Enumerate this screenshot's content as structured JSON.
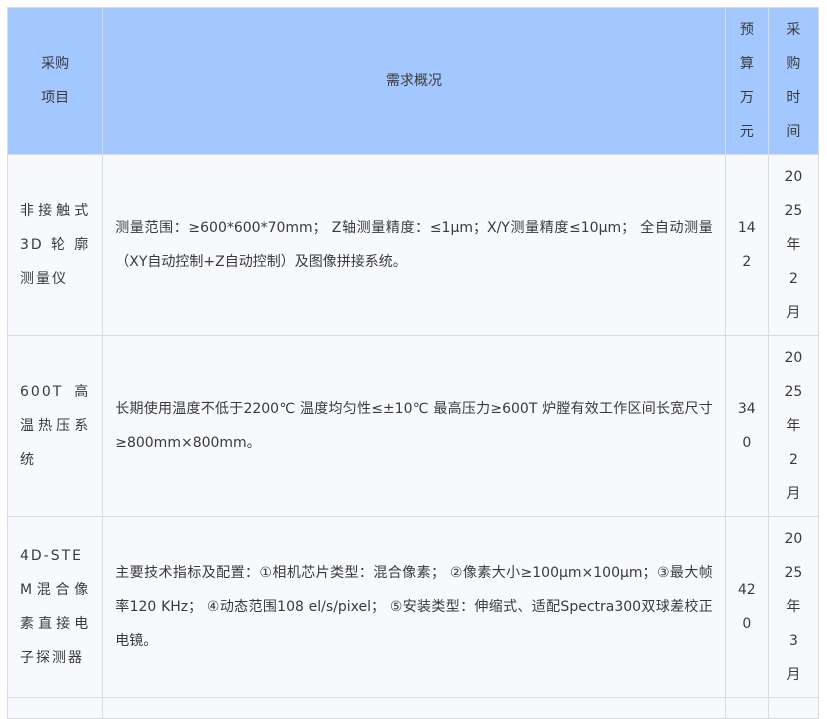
{
  "table": {
    "headers": {
      "item": "采购项目",
      "requirement": "需求概况",
      "budget": "预算万元",
      "time": "采购时间"
    },
    "rows": [
      {
        "item": "非接触式3D轮廓测量仪",
        "requirement": "测量范围：≥600*600*70mm； Z轴测量精度：≤1μm；X/Y测量精度≤10μm； 全自动测量（XY自动控制+Z自动控制）及图像拼接系统。",
        "budget": "142",
        "time": "2025年2月"
      },
      {
        "item": "600T高温热压系统",
        "requirement": "长期使用温度不低于2200℃ 温度均匀性≤±10℃ 最高压力≥600T 炉膛有效工作区间长宽尺寸≥800mm×800mm。",
        "budget": "340",
        "time": "2025年2月"
      },
      {
        "item": "4D-STEM混合像素直接电子探测器",
        "requirement": "主要技术指标及配置：①相机芯片类型：混合像素； ②像素大小≥100μm×100μm；③最大帧率120 KHz； ④动态范围108 el/s/pixel； ⑤安装类型：伸缩式、适配Spectra300双球差校正电镜。",
        "budget": "420",
        "time": "2025年3月"
      }
    ]
  },
  "colors": {
    "header_bg": "#a3c7ff",
    "row_bg": "#f7f9fd",
    "border": "#d9dde3",
    "text": "#3a3a3a"
  }
}
